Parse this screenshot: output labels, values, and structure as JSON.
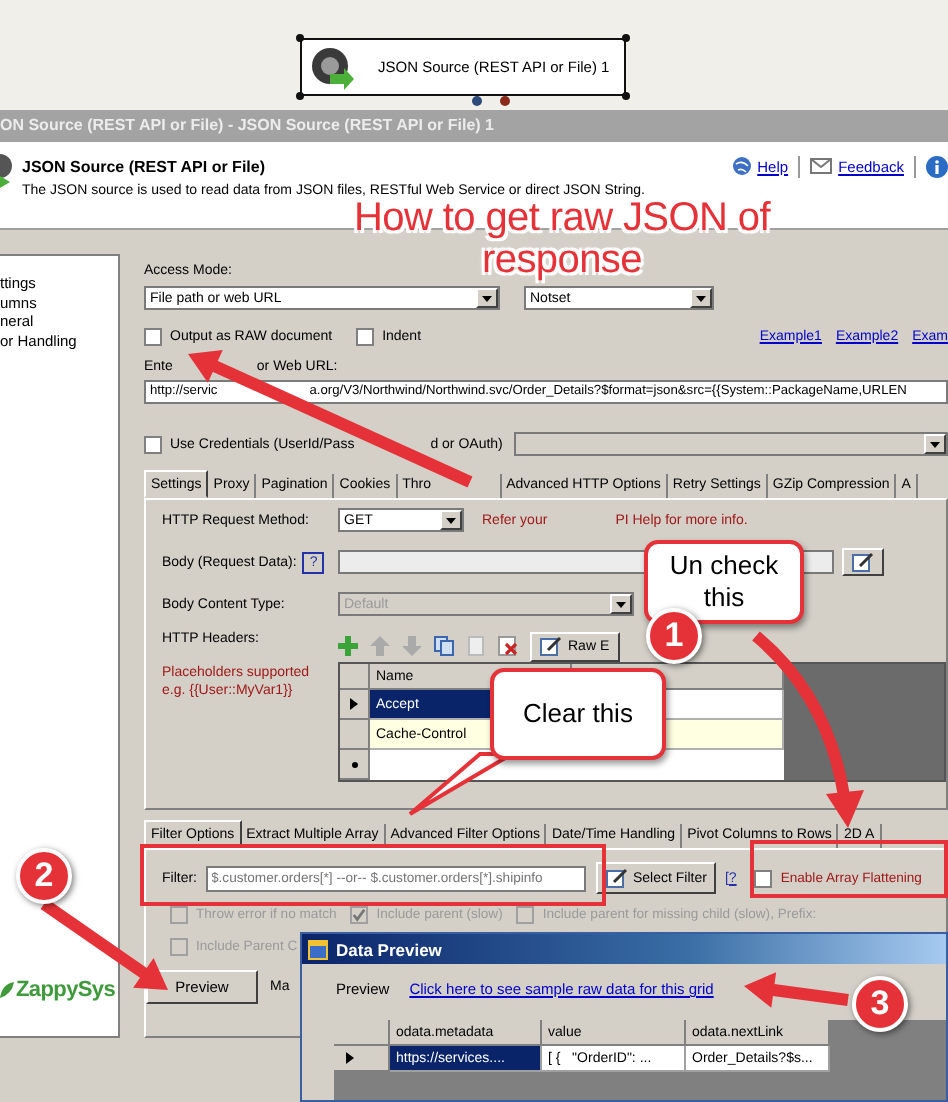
{
  "canvas": {
    "node_label": "JSON Source (REST API or File) 1"
  },
  "window": {
    "title": "ON Source (REST API or File) - JSON Source (REST API or File) 1"
  },
  "header": {
    "title": "JSON Source (REST API or File)",
    "description": "The JSON source is used to read data from JSON files, RESTful Web Service or direct JSON String.",
    "help": "Help",
    "feedback": "Feedback"
  },
  "sidebar": {
    "items": [
      "ttings",
      "umns",
      "neral",
      "or Handling"
    ],
    "logo": "ZappySys"
  },
  "access_mode": {
    "label": "Access Mode:",
    "mode": "File path or web URL",
    "option": "Notset"
  },
  "output_options": [
    {
      "label": "Output as RAW document",
      "checked": false
    },
    {
      "label": "Indent",
      "checked": false
    }
  ],
  "examples": [
    "Example1",
    "Example2",
    "Exam"
  ],
  "url": {
    "label": [
      "Ente",
      "or Web URL:"
    ],
    "value": [
      "http://servic",
      "a.org/V3/Northwind/Northwind.svc/Order_Details?$format=json&src={{System::PackageName,URLEN"
    ]
  },
  "credentials": {
    "label": [
      "Use Credentials (UserId/Pass",
      "d or OAuth)"
    ],
    "checked": false
  },
  "tabs": [
    {
      "label": "Settings",
      "selected": true
    },
    {
      "label": "Proxy",
      "selected": false
    },
    {
      "label": "Pagination",
      "selected": false
    },
    {
      "label": "Cookies",
      "selected": false
    },
    {
      "label": "Thro",
      "selected": false
    },
    {
      "label": "Advanced HTTP Options",
      "selected": false
    },
    {
      "label": "Retry Settings",
      "selected": false
    },
    {
      "label": "GZip Compression",
      "selected": false
    },
    {
      "label": "A",
      "selected": false
    }
  ],
  "settings": {
    "method_label": "HTTP Request Method:",
    "method": "GET",
    "hint": [
      "Refer your",
      "PI Help for more info."
    ],
    "body_label": "Body (Request Data):",
    "body_help": "?",
    "content_type_label": "Body Content Type:",
    "content_type": "Default",
    "headers_label": "HTTP Headers:",
    "placeholder_note": "Placeholders supported e.g. {{User::MyVar1}}",
    "raw_edit": "Raw E"
  },
  "headers": {
    "column": "Name",
    "rows": [
      {
        "name": "Accept",
        "selected": true
      },
      {
        "name": "Cache-Control",
        "selected": false
      }
    ]
  },
  "filter_tabs": [
    {
      "label": "Filter Options",
      "selected": true
    },
    {
      "label": "Extract Multiple Array",
      "selected": false
    },
    {
      "label": "Advanced Filter Options",
      "selected": false
    },
    {
      "label": "Date/Time Handling",
      "selected": false
    },
    {
      "label": "Pivot Columns to Rows",
      "selected": false
    },
    {
      "label": "2D A",
      "selected": false
    }
  ],
  "filter": {
    "label": "Filter:",
    "placeholder": "$.customer.orders[*] --or-- $.customer.orders[*].shipinfo",
    "button": "Select Filter",
    "help": "[?",
    "flatten": {
      "label": "Enable Array Flattening",
      "checked": false
    }
  },
  "filter_options": [
    {
      "label": "Throw error if no match",
      "checked": false,
      "disabled": true
    },
    {
      "label": "Include parent (slow)",
      "checked": true,
      "disabled": true
    },
    {
      "label": "Include parent for missing child (slow), Prefix:",
      "checked": false,
      "disabled": true
    },
    {
      "label": "Include Parent C",
      "checked": false,
      "disabled": true
    }
  ],
  "preview_button": "Preview",
  "mode_label": "Ma",
  "data_preview": {
    "title": "Data Preview",
    "label": "Preview",
    "link": "Click here to see sample raw data for this grid",
    "columns": [
      "odata.metadata",
      "value",
      "odata.nextLink"
    ],
    "rows": [
      {
        "cells": [
          "https://services....",
          "[ {   \"OrderID\": ...",
          "Order_Details?$s..."
        ],
        "selected": true
      }
    ]
  },
  "annotations": {
    "title": "How to get raw JSON of response",
    "callouts": [
      "Un check this",
      "Clear this"
    ],
    "badges": [
      "1",
      "2",
      "3"
    ]
  }
}
